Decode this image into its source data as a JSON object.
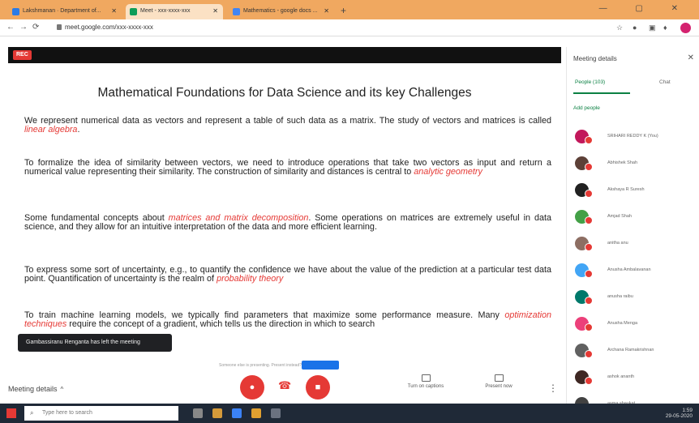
{
  "browser": {
    "tabs": [
      {
        "label": "Lakshmanan · Department of..."
      },
      {
        "label": "Meet - xxx-xxxx-xxx"
      },
      {
        "label": "Mathematics - google docs ..."
      }
    ],
    "new_tab": "+",
    "window_controls": "—  ▢  ✕",
    "url": "meet.google.com/xxx-xxxx-xxx"
  },
  "presentation": {
    "rec_label": "REC",
    "title": "Mathematical Foundations for Data Science and its key  Challenges",
    "paragraphs": [
      {
        "pre": "We represent numerical data as vectors and represent a table of such data as a matrix. The study of vectors and matrices is called ",
        "hl": "linear algebra",
        "post": "."
      },
      {
        "pre": "To formalize the idea of similarity between vectors, we need to introduce operations that take two vectors as input and return a numerical value representing their similarity. The construction of similarity and distances is central to ",
        "hl": "analytic geometry",
        "post": ""
      },
      {
        "pre": "Some fundamental concepts about ",
        "hl": "matrices and matrix decomposition",
        "post": ". Some operations on matrices are extremely useful in data science, and they allow for an intuitive interpretation of the data and more efficient learning."
      },
      {
        "pre": "To  express some sort of uncertainty, e.g., to quantify the confidence we have about the value of the prediction at a particular test data point. Quantification of uncertainty is the realm of ",
        "hl": "probability theory",
        "post": ""
      },
      {
        "pre": "To train machine learning models, we typically find parameters that maximize some performance measure. Many ",
        "hl": "optimization techniques",
        "post": " require the concept of a gradient, which tells us the direction in which to search"
      }
    ],
    "toast": "Gambassiranu Renganta has left the meeting",
    "share_notice": "Someone else is presenting. Present instead?"
  },
  "bottom": {
    "meeting_details": "Meeting details",
    "chevron": "^",
    "captions_label": "Turn on captions",
    "present_label": "Present now",
    "kebab": "⋮"
  },
  "side_panel": {
    "title": "Meeting details",
    "close": "✕",
    "people_tab": "People (103)",
    "chat_tab": "Chat",
    "add_people": "Add people",
    "participants": [
      {
        "name": "SRIHARI REDDY K (You)",
        "color": "#c2185b"
      },
      {
        "name": "Abhishek Shah",
        "color": "#5d4037"
      },
      {
        "name": "Akshaya R Suresh",
        "color": "#212121"
      },
      {
        "name": "Amjad Shah",
        "color": "#43a047"
      },
      {
        "name": "anitha anu",
        "color": "#8d6e63"
      },
      {
        "name": "Anusha Ambalavanan",
        "color": "#42a5f5"
      },
      {
        "name": "anusha raibu",
        "color": "#00796b"
      },
      {
        "name": "Anusha Menga",
        "color": "#ec407a"
      },
      {
        "name": "Archana Ramakrishnan",
        "color": "#616161"
      },
      {
        "name": "ashok ananth",
        "color": "#3e2723"
      },
      {
        "name": "asma shaukat",
        "color": "#424242"
      }
    ]
  },
  "taskbar": {
    "search_placeholder": "Type here to search",
    "time": "1:59",
    "date": "29-05-2020"
  }
}
